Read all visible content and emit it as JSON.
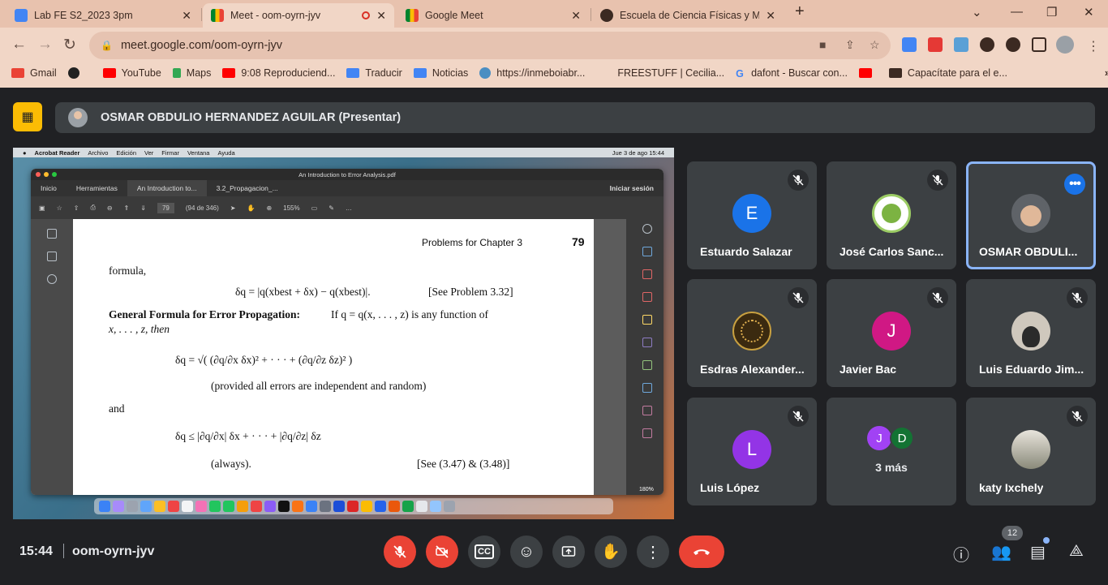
{
  "browser": {
    "tabs": [
      {
        "title": "Lab FE S2_2023 3pm",
        "close": "✕"
      },
      {
        "title": "Meet - oom-oyrn-jyv",
        "close": "✕"
      },
      {
        "title": "Google Meet",
        "close": "✕"
      },
      {
        "title": "Escuela de Ciencia Físicas y Mate",
        "close": "✕"
      }
    ],
    "new_tab": "+",
    "url": "meet.google.com/oom-oyrn-jyv",
    "bookmarks": [
      "Gmail",
      "YouTube",
      "Maps",
      "9:08 Reproduciend...",
      "Traducir",
      "Noticias",
      "https://inmeboiabr...",
      "FREESTUFF | Cecilia...",
      "dafont - Buscar con...",
      "Capacítate para el e..."
    ],
    "colors": {
      "tabstrip": "#e8c2ae",
      "toolbar": "#f1d6c6"
    }
  },
  "meet": {
    "presenter_title": "OSMAR OBDULIO HERNANDEZ AGUILAR (Presentar)",
    "shared_screen": {
      "menubar": [
        "Acrobat Reader",
        "Archivo",
        "Edición",
        "Ver",
        "Firmar",
        "Ventana",
        "Ayuda"
      ],
      "menubar_clock": "Jue 3 de ago  15:44",
      "window_title": "An Introduction to Error Analysis.pdf",
      "tabs": [
        "Inicio",
        "Herramientas",
        "An Introduction to...",
        "3.2_Propagacion_..."
      ],
      "sign_in": "Iniciar sesión",
      "page_field": "79",
      "page_count": "(94 de 346)",
      "zoom": "155%",
      "pdf": {
        "header": "Problems for Chapter 3",
        "page_number": "79",
        "lines": [
          "formula,",
          "δq  =  |q(xbest + δx) − q(xbest)|.",
          "[See Problem 3.32]",
          "General Formula for Error Propagation:",
          "If  q  =  q(x, . . . , z)  is any function of",
          "x, . . . , z, then",
          "δq  =  √( (∂q/∂x δx)² + · · · + (∂q/∂z δz)² )",
          "(provided all errors are independent and random)",
          "and",
          "δq  ≤  |∂q/∂x| δx + · · · + |∂q/∂z| δz",
          "(always).",
          "[See (3.47) & (3.48)]"
        ]
      },
      "screen_zoom": "180%"
    },
    "participants": [
      {
        "name": "Estuardo Salazar",
        "initial": "E",
        "color": "#1a73e8"
      },
      {
        "name": "José Carlos Sanc...",
        "initial": "",
        "color": "#ffffff"
      },
      {
        "name": "OSMAR OBDULI...",
        "initial": "",
        "color": "#5f6368"
      },
      {
        "name": "Esdras Alexander...",
        "initial": "",
        "color": "#3b2a10"
      },
      {
        "name": "Javier Bac",
        "initial": "J",
        "color": "#d01884"
      },
      {
        "name": "Luis Eduardo Jim...",
        "initial": "",
        "color": "#7a6a5a"
      },
      {
        "name": "Luis López",
        "initial": "L",
        "color": "#9334e6"
      },
      {
        "name": "katy Ixchely",
        "initial": "",
        "color": "#8a8a7a"
      }
    ],
    "more_tile": {
      "label": "3 más",
      "initials": [
        "J",
        "D"
      ],
      "colors": [
        "#a142f4",
        "#137333"
      ]
    },
    "more_options": "•••",
    "bottom": {
      "time": "15:44",
      "meeting_code": "oom-oyrn-jyv",
      "people_count": "12"
    }
  }
}
